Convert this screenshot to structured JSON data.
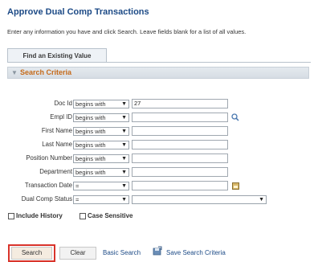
{
  "page": {
    "title": "Approve Dual Comp Transactions",
    "instructions": "Enter any information you have and click Search. Leave fields blank for a list of all values."
  },
  "tabs": [
    {
      "label": "Find an Existing Value"
    }
  ],
  "section": {
    "title": "Search Criteria"
  },
  "fields": [
    {
      "label": "Doc Id",
      "operator": "begins with",
      "value": "27"
    },
    {
      "label": "Empl ID",
      "operator": "begins with",
      "value": ""
    },
    {
      "label": "First Name",
      "operator": "begins with",
      "value": ""
    },
    {
      "label": "Last Name",
      "operator": "begins with",
      "value": ""
    },
    {
      "label": "Position Number",
      "operator": "begins with",
      "value": ""
    },
    {
      "label": "Department",
      "operator": "begins with",
      "value": ""
    },
    {
      "label": "Transaction Date",
      "operator": "=",
      "value": ""
    },
    {
      "label": "Dual Comp Status",
      "operator": "=",
      "value": ""
    }
  ],
  "checkboxes": [
    {
      "label": "Include History",
      "checked": false
    },
    {
      "label": "Case Sensitive",
      "checked": false
    }
  ],
  "actions": {
    "search": "Search",
    "clear": "Clear",
    "basic_search": "Basic Search",
    "save_criteria": "Save Search Criteria"
  },
  "colors": {
    "title": "#1c4a86",
    "section_title": "#c56a1a",
    "highlight": "#d9342b"
  }
}
